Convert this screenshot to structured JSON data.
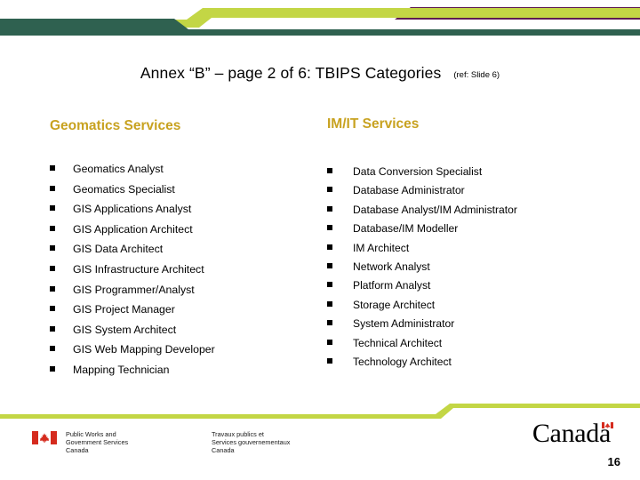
{
  "slide": {
    "title_main": "Annex “B” – page 2 of 6:  TBIPS Categories",
    "title_ref": "(ref: Slide 6)",
    "page_number": "16"
  },
  "colors": {
    "dark_green": "#2f6150",
    "lime_green": "#c3d645",
    "purple": "#5e1b52",
    "heading_gold": "#c8a220",
    "flag_red": "#d52b1e",
    "body_text": "#000000"
  },
  "columns": [
    {
      "heading": "Geomatics Services",
      "items": [
        "Geomatics Analyst",
        "Geomatics Specialist",
        "GIS Applications Analyst",
        "GIS Application Architect",
        "GIS Data Architect",
        "GIS Infrastructure Architect",
        "GIS Programmer/Analyst",
        "GIS Project Manager",
        "GIS System Architect",
        "GIS Web Mapping Developer",
        "Mapping Technician"
      ]
    },
    {
      "heading": "IM/IT Services",
      "items": [
        "Data Conversion Specialist",
        "Database Administrator",
        "Database Analyst/IM Administrator",
        "Database/IM Modeller",
        "IM Architect",
        "Network Analyst",
        "Platform Analyst",
        "Storage Architect",
        "System Administrator",
        "Technical Architect",
        "Technology Architect"
      ]
    }
  ],
  "footer": {
    "department_en_line1": "Public Works and",
    "department_en_line2": "Government Services",
    "department_en_line3": "Canada",
    "department_fr_line1": "Travaux publics et",
    "department_fr_line2": "Services gouvernementaux",
    "department_fr_line3": "Canada",
    "wordmark": "Canada"
  }
}
